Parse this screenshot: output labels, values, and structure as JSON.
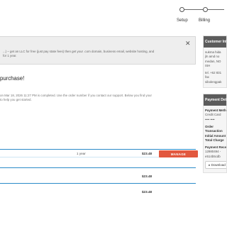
{
  "stepper": {
    "steps": [
      {
        "label": "Setup"
      },
      {
        "label": "Billing"
      },
      {
        "label": ""
      }
    ]
  },
  "notice": {
    "text": "...) – get an LLC for free (just pay state fees) then get your .com domain, business email, website hosting, and",
    "text2": "for 1 year."
  },
  "confirmation": {
    "title": "purchase!",
    "line1": "on Mar 18, 2026 11:27 PM is completed. Use the order number if you contact our support. Below you find your",
    "line2": "to help you get started."
  },
  "orders": [
    {
      "period": "1 year",
      "price": "$23.48",
      "action": "MANAGE"
    },
    {
      "period": "",
      "price": "$23.48"
    },
    {
      "period": "",
      "price": "$23.48"
    }
  ],
  "sidebar": {
    "customer": {
      "title": "Customer Information",
      "lines": [
        "sukma hida",
        "jln amd no",
        "medan, NO",
        "ISH",
        "tel. +62 831",
        "fax",
        "sibolengpak"
      ]
    },
    "payment": {
      "title": "Payment Details",
      "method_label": "Payment Method",
      "method_value": "Credit Card",
      "card_mask": "•••• ••••",
      "order_label": "Order",
      "transaction_label": "Transaction",
      "initial_label": "Initial Amount",
      "total_label": "Total Charge",
      "receipt_label": "Payment Receipt",
      "receipt_line1": "12980494 -",
      "receipt_line2": "e514b5cdb",
      "download_label": "Download"
    }
  }
}
